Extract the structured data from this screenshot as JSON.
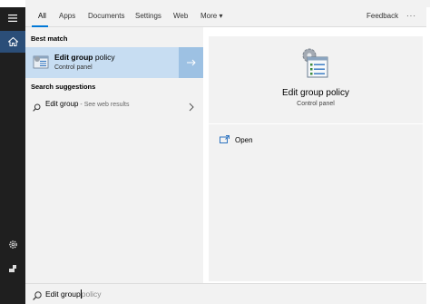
{
  "nav": {
    "tabs": [
      "All",
      "Apps",
      "Documents",
      "Settings",
      "Web",
      "More"
    ],
    "more_arrow": "▾",
    "feedback": "Feedback",
    "ellipsis": "···"
  },
  "left": {
    "best_match_heading": "Best match",
    "best_match": {
      "title": "Edit group policy",
      "bold_part": "Edit group",
      "rest_part": " policy",
      "subtitle": "Control panel"
    },
    "suggestions_heading": "Search suggestions",
    "suggestion": {
      "query": "Edit group",
      "hint": " - See web results"
    }
  },
  "detail": {
    "title": "Edit group policy",
    "subtitle": "Control panel",
    "open_label": "Open"
  },
  "search": {
    "typed": "Edit group",
    "completion": "policy"
  },
  "colors": {
    "accent": "#0078d7",
    "rail": "#1f1f1f",
    "selected_row": "#c7ddf2",
    "selected_arrow": "#9dc1e3"
  }
}
